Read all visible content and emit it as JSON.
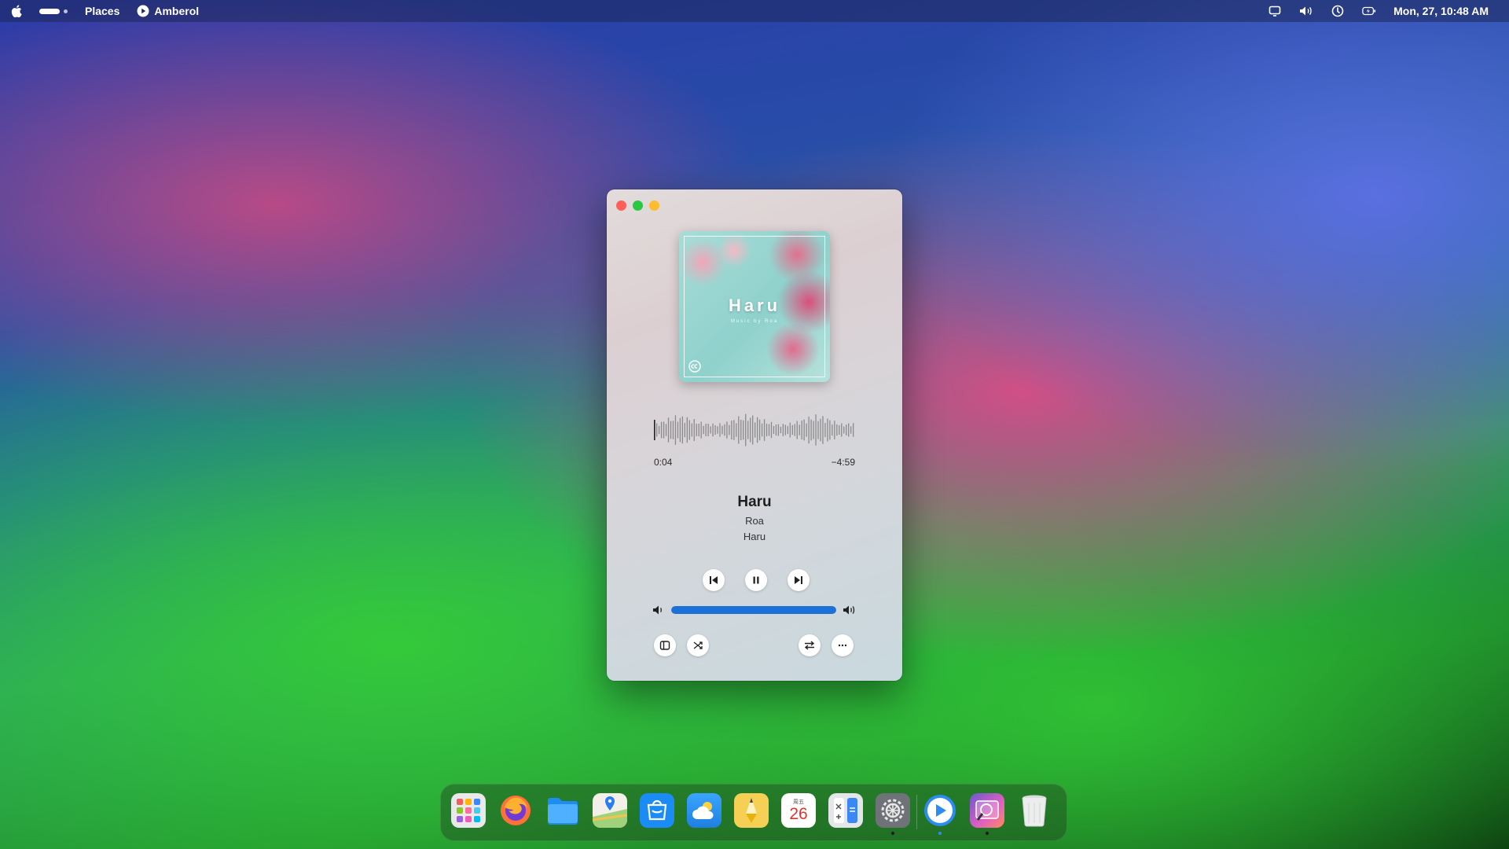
{
  "menubar": {
    "places_label": "Places",
    "app_name": "Amberol",
    "datetime": "Mon, 27, 10:48 AM"
  },
  "player": {
    "cover_title": "Haru",
    "cover_subtitle": "Music by Roa",
    "time_elapsed": "0:04",
    "time_remaining": "−4:59",
    "track_title": "Haru",
    "track_artist": "Roa",
    "track_album": "Haru",
    "volume": 1.0,
    "accent_color": "#1c71d8"
  },
  "dock": {
    "items": [
      "launchpad",
      "firefox",
      "files",
      "maps",
      "software-center",
      "weather",
      "text-editor",
      "calendar",
      "calculator",
      "settings",
      "amberol",
      "screenshot",
      "trash"
    ],
    "calendar_weekday": "周五",
    "calendar_day": "26"
  }
}
